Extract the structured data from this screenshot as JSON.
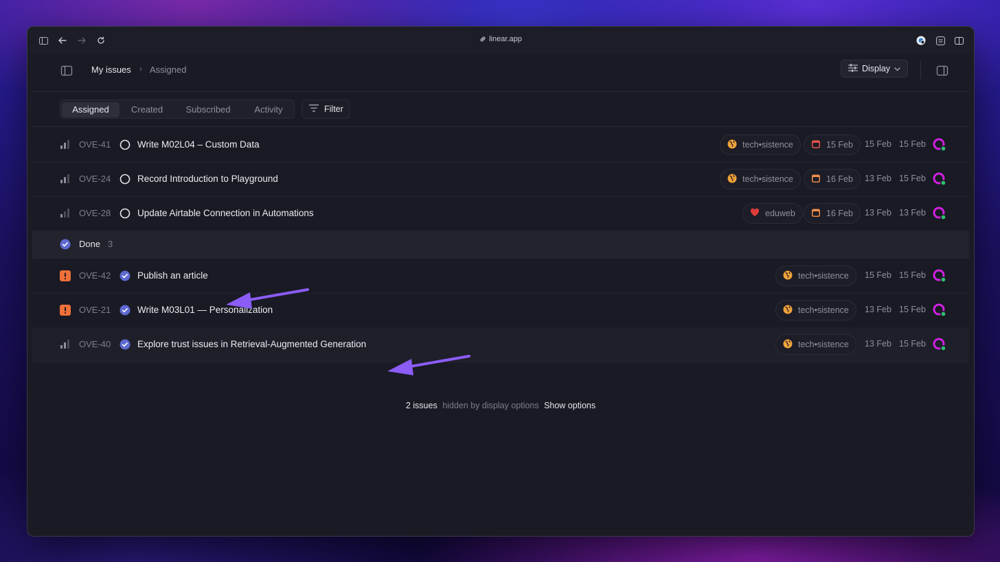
{
  "browser": {
    "url": "linear.app"
  },
  "header": {
    "breadcrumb_root": "My issues",
    "breadcrumb_separator": "›",
    "breadcrumb_current": "Assigned",
    "display_label": "Display"
  },
  "tabs": [
    {
      "label": "Assigned",
      "active": true
    },
    {
      "label": "Created",
      "active": false
    },
    {
      "label": "Subscribed",
      "active": false
    },
    {
      "label": "Activity",
      "active": false
    }
  ],
  "filter_label": "Filter",
  "issues_open": [
    {
      "id": "OVE-41",
      "priority": "medium-priority-icon",
      "status": "todo-circle-icon",
      "title": "Write M02L04 – Custom Data",
      "label": "tech•sistence",
      "label_icon": "project-globe-icon",
      "due": "15 Feb",
      "due_color": "#e5534b",
      "created": "15 Feb",
      "updated": "15 Feb"
    },
    {
      "id": "OVE-24",
      "priority": "medium-priority-icon",
      "status": "todo-circle-icon",
      "title": "Record Introduction to Playground",
      "label": "tech•sistence",
      "label_icon": "project-globe-icon",
      "due": "16 Feb",
      "due_color": "#f08c4a",
      "created": "13 Feb",
      "updated": "15 Feb"
    },
    {
      "id": "OVE-28",
      "priority": "low-priority-icon",
      "status": "todo-circle-icon",
      "title": "Update Airtable Connection in Automations",
      "label": "eduweb",
      "label_icon": "heart-icon",
      "due": "16 Feb",
      "due_color": "#f08c4a",
      "created": "13 Feb",
      "updated": "13 Feb"
    }
  ],
  "done_group": {
    "label": "Done",
    "count": "3"
  },
  "issues_done": [
    {
      "id": "OVE-42",
      "priority": "urgent-priority-icon",
      "title": "Publish an article",
      "label": "tech•sistence",
      "created": "15 Feb",
      "updated": "15 Feb"
    },
    {
      "id": "OVE-21",
      "priority": "urgent-priority-icon",
      "title": "Write M03L01 — Personalization",
      "label": "tech•sistence",
      "created": "13 Feb",
      "updated": "15 Feb"
    },
    {
      "id": "OVE-40",
      "priority": "medium-priority-icon",
      "title": "Explore trust issues in Retrieval-Augmented Generation",
      "label": "tech•sistence",
      "created": "13 Feb",
      "updated": "15 Feb"
    }
  ],
  "footer": {
    "count_text": "2 issues",
    "hidden_text": "hidden by display options",
    "show_options": "Show options"
  },
  "colors": {
    "accent": "#5e6ad2",
    "urgent": "#f0703a",
    "annotation_arrow": "#8b5cf6",
    "avatar_ring": "#d021e0",
    "online": "#2fbf71"
  }
}
